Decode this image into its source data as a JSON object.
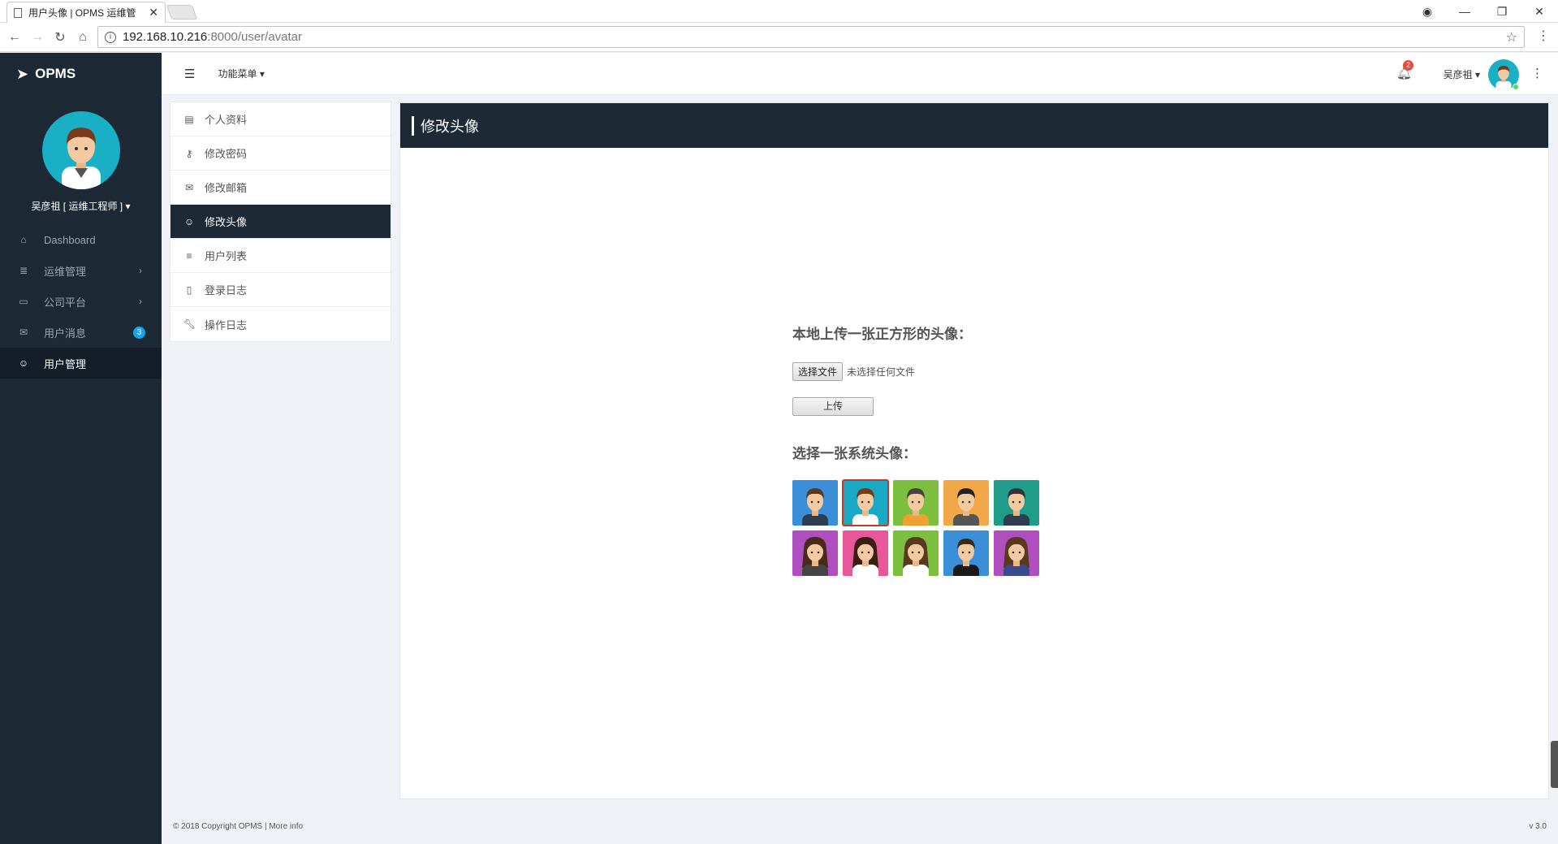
{
  "browser": {
    "tab_title": "用户头像 | OPMS 运维管",
    "tab_close": "✕",
    "url_host": "192.168.10.216",
    "url_path": ":8000/user/avatar"
  },
  "app": {
    "logo": "OPMS"
  },
  "sidebar": {
    "profile_name": "吴彦祖 [ 运维工程师 ]",
    "items": [
      {
        "label": "Dashboard",
        "icon": "home-icon"
      },
      {
        "label": "运维管理",
        "icon": "server-icon"
      },
      {
        "label": "公司平台",
        "icon": "monitor-icon"
      },
      {
        "label": "用户消息",
        "icon": "mail-icon",
        "badge": "3"
      },
      {
        "label": "用户管理",
        "icon": "user-icon"
      }
    ]
  },
  "header": {
    "func_menu": "功能菜单",
    "notif_count": "2",
    "username": "吴彦祖"
  },
  "subnav": {
    "items": [
      {
        "label": "个人资料",
        "icon": "card-icon"
      },
      {
        "label": "修改密码",
        "icon": "key-icon"
      },
      {
        "label": "修改邮箱",
        "icon": "envelope-icon"
      },
      {
        "label": "修改头像",
        "icon": "smile-icon"
      },
      {
        "label": "用户列表",
        "icon": "list-icon"
      },
      {
        "label": "登录日志",
        "icon": "file-icon"
      },
      {
        "label": "操作日志",
        "icon": "wrench-icon"
      }
    ]
  },
  "panel": {
    "title": "修改头像",
    "upload_title": "本地上传一张正方形的头像：",
    "choose_file": "选择文件",
    "no_file": "未选择任何文件",
    "upload_btn": "上传",
    "system_title": "选择一张系统头像："
  },
  "avatars": [
    {
      "bg": "#3b8fd9",
      "hair": "#5a3a1e",
      "skin": "#f2c9a0",
      "shirt": "#2c3e50"
    },
    {
      "bg": "#1aa9c4",
      "hair": "#7a3a1a",
      "skin": "#f2c9a0",
      "shirt": "#ffffff",
      "selected": true
    },
    {
      "bg": "#7cbf3e",
      "hair": "#444444",
      "skin": "#f2c9a0",
      "shirt": "#f0a030"
    },
    {
      "bg": "#f0a848",
      "hair": "#222222",
      "skin": "#f2c9a0",
      "shirt": "#555555"
    },
    {
      "bg": "#1f9d8a",
      "hair": "#333333",
      "skin": "#f2c9a0",
      "shirt": "#2c3e50"
    },
    {
      "bg": "#b04fc0",
      "hair": "#4a2a18",
      "skin": "#f2c9a0",
      "shirt": "#444444"
    },
    {
      "bg": "#e8579a",
      "hair": "#3a1e10",
      "skin": "#f2c9a0",
      "shirt": "#ffffff"
    },
    {
      "bg": "#7cbf3e",
      "hair": "#5a3a1e",
      "skin": "#f2c9a0",
      "shirt": "#ffffff"
    },
    {
      "bg": "#3b8fd9",
      "hair": "#3a2a18",
      "skin": "#f2c9a0",
      "shirt": "#1a1a1a"
    },
    {
      "bg": "#b04fc0",
      "hair": "#5a3a1e",
      "skin": "#f2c9a0",
      "shirt": "#3a4a8a"
    }
  ],
  "footer": {
    "copyright": "© 2018 Copyright OPMS | More info",
    "version": "v 3.0"
  }
}
